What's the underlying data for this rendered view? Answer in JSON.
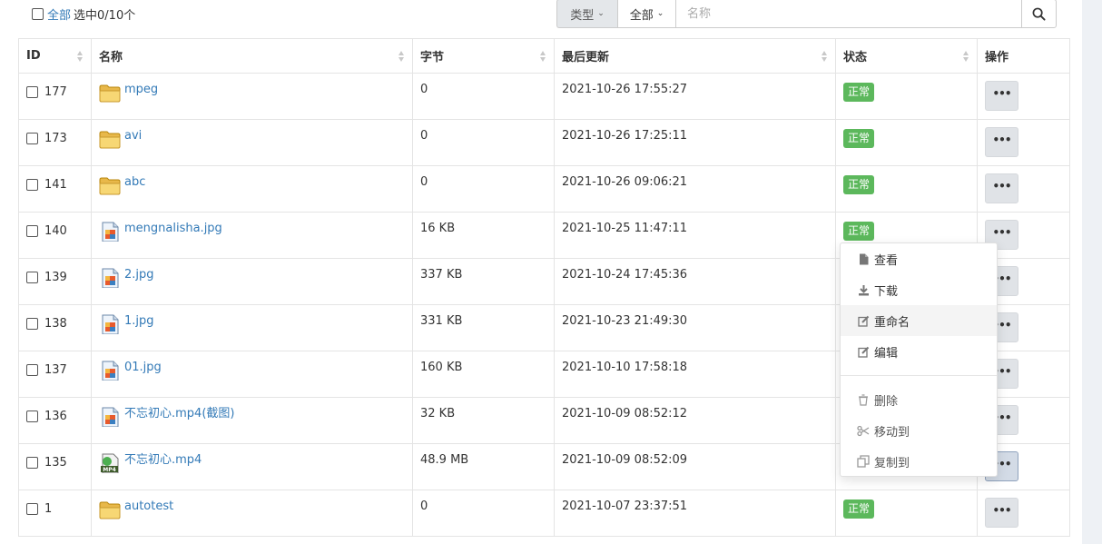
{
  "toolbar": {
    "select_all_label": "全部",
    "selected_status": "选中0/10个",
    "type_label": "类型",
    "scope_label": "全部",
    "search_placeholder": "名称"
  },
  "columns": {
    "id": "ID",
    "name": "名称",
    "size": "字节",
    "updated": "最后更新",
    "status": "状态",
    "actions": "操作"
  },
  "rows": [
    {
      "id": "177",
      "name": "mpeg",
      "icon": "folder-icon",
      "size": "0",
      "updated": "2021-10-26 17:55:27",
      "status": "正常"
    },
    {
      "id": "173",
      "name": "avi",
      "icon": "folder-icon",
      "size": "0",
      "updated": "2021-10-26 17:25:11",
      "status": "正常"
    },
    {
      "id": "141",
      "name": "abc",
      "icon": "folder-icon",
      "size": "0",
      "updated": "2021-10-26 09:06:21",
      "status": "正常"
    },
    {
      "id": "140",
      "name": "mengnalisha.jpg",
      "icon": "image-file-icon",
      "size": "16 KB",
      "updated": "2021-10-25 11:47:11",
      "status": "正常"
    },
    {
      "id": "139",
      "name": "2.jpg",
      "icon": "image-file-icon",
      "size": "337 KB",
      "updated": "2021-10-24 17:45:36",
      "status": ""
    },
    {
      "id": "138",
      "name": "1.jpg",
      "icon": "image-file-icon",
      "size": "331 KB",
      "updated": "2021-10-23 21:49:30",
      "status": ""
    },
    {
      "id": "137",
      "name": "01.jpg",
      "icon": "image-file-icon",
      "size": "160 KB",
      "updated": "2021-10-10 17:58:18",
      "status": ""
    },
    {
      "id": "136",
      "name": "不忘初心.mp4(截图)",
      "icon": "image-file-icon",
      "size": "32 KB",
      "updated": "2021-10-09 08:52:12",
      "status": ""
    },
    {
      "id": "135",
      "name": "不忘初心.mp4",
      "icon": "mp4-file-icon",
      "size": "48.9 MB",
      "updated": "2021-10-09 08:52:09",
      "status": ""
    },
    {
      "id": "1",
      "name": "autotest",
      "icon": "folder-icon",
      "size": "0",
      "updated": "2021-10-07 23:37:51",
      "status": "正常"
    }
  ],
  "action_menu": {
    "items": [
      {
        "label": "查看",
        "icon": "file-icon"
      },
      {
        "label": "下载",
        "icon": "download-icon"
      },
      {
        "label": "重命名",
        "icon": "edit-icon"
      },
      {
        "label": "编辑",
        "icon": "edit-icon"
      }
    ],
    "danger_items": [
      {
        "label": "删除",
        "icon": "trash-icon"
      },
      {
        "label": "移动到",
        "icon": "scissors-icon"
      },
      {
        "label": "复制到",
        "icon": "copy-icon"
      }
    ]
  },
  "colors": {
    "link": "#337ab7",
    "status_ok": "#5cb85c",
    "button_bg": "#e0e3e7"
  }
}
